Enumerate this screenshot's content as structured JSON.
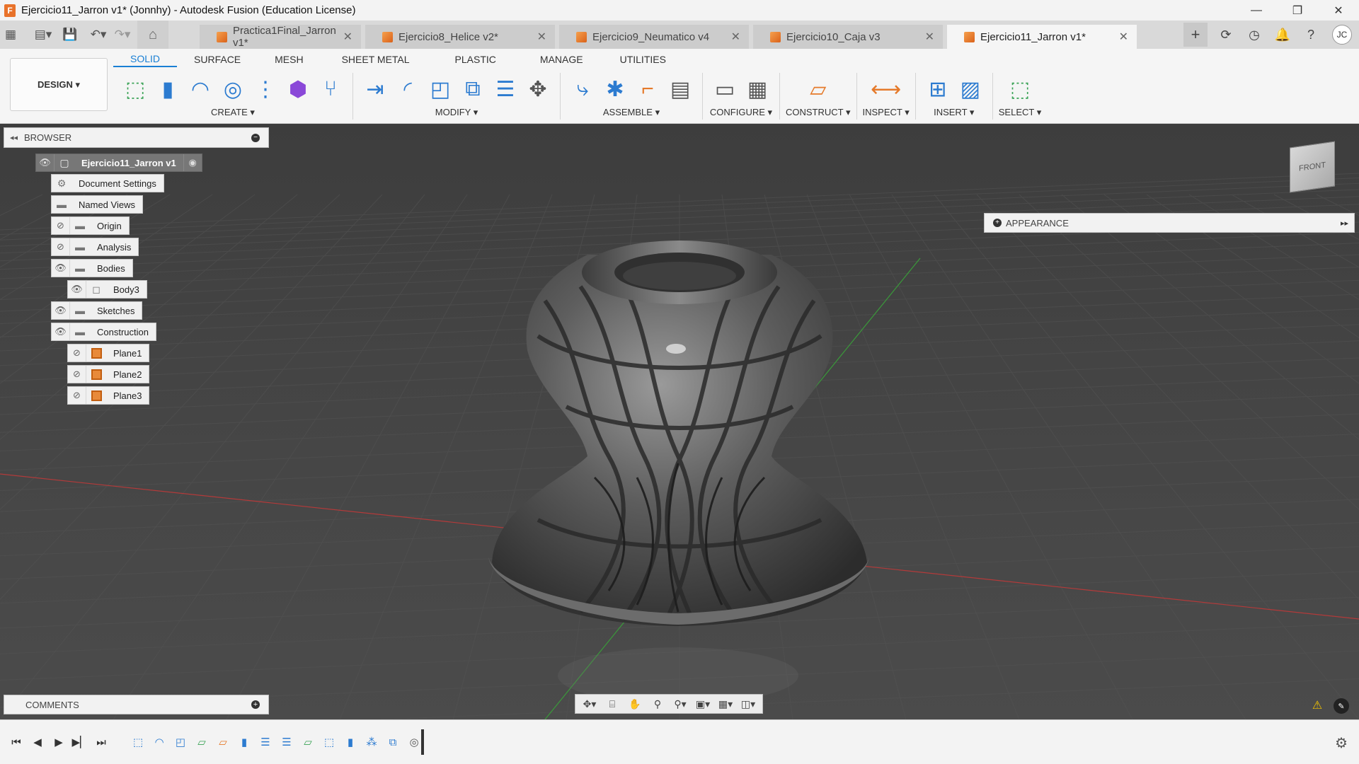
{
  "window": {
    "title": "Ejercicio11_Jarron v1* (Jonnhy) - Autodesk Fusion (Education License)",
    "app_icon": "F",
    "controls": [
      "minimize-icon",
      "restore-icon",
      "close-icon"
    ]
  },
  "tabs": [
    {
      "label": "Practica1Final_Jarron v1*",
      "active": false
    },
    {
      "label": "Ejercicio8_Helice v2*",
      "active": false
    },
    {
      "label": "Ejercicio9_Neumatico v4",
      "active": false
    },
    {
      "label": "Ejercicio10_Caja v3",
      "active": false
    },
    {
      "label": "Ejercicio11_Jarron v1*",
      "active": true
    }
  ],
  "user_avatar": "JC",
  "toolbar": {
    "workspace_label": "DESIGN ▾",
    "workspace_tabs": [
      "SOLID",
      "SURFACE",
      "MESH",
      "SHEET METAL",
      "PLASTIC",
      "MANAGE",
      "UTILITIES"
    ],
    "active_workspace_tab": "SOLID",
    "groups": {
      "create": "CREATE ▾",
      "modify": "MODIFY ▾",
      "assemble": "ASSEMBLE ▾",
      "configure": "CONFIGURE ▾",
      "construct": "CONSTRUCT ▾",
      "inspect": "INSPECT ▾",
      "insert": "INSERT ▾",
      "select": "SELECT ▾"
    }
  },
  "browser": {
    "title": "BROWSER",
    "root": "Ejercicio11_Jarron v1",
    "items": [
      {
        "label": "Document Settings",
        "icon": "gear-icon"
      },
      {
        "label": "Named Views",
        "icon": "folder-icon"
      },
      {
        "label": "Origin",
        "icon": "folder-icon"
      },
      {
        "label": "Analysis",
        "icon": "folder-icon"
      },
      {
        "label": "Bodies",
        "icon": "folder-icon"
      },
      {
        "label": "Body3",
        "icon": "body-icon"
      },
      {
        "label": "Sketches",
        "icon": "folder-icon"
      },
      {
        "label": "Construction",
        "icon": "folder-icon"
      },
      {
        "label": "Plane1",
        "icon": "plane-icon"
      },
      {
        "label": "Plane2",
        "icon": "plane-icon"
      },
      {
        "label": "Plane3",
        "icon": "plane-icon"
      }
    ]
  },
  "appearance_panel": {
    "title": "APPEARANCE"
  },
  "comments_panel": {
    "title": "COMMENTS"
  },
  "viewcube": {
    "face": "FRONT"
  },
  "colors": {
    "accent": "#1a7fd4",
    "viewport_bg": "#444444",
    "model": "#5a5a5a",
    "x_axis": "#b33a3a",
    "y_axis": "#3a9a3a"
  }
}
